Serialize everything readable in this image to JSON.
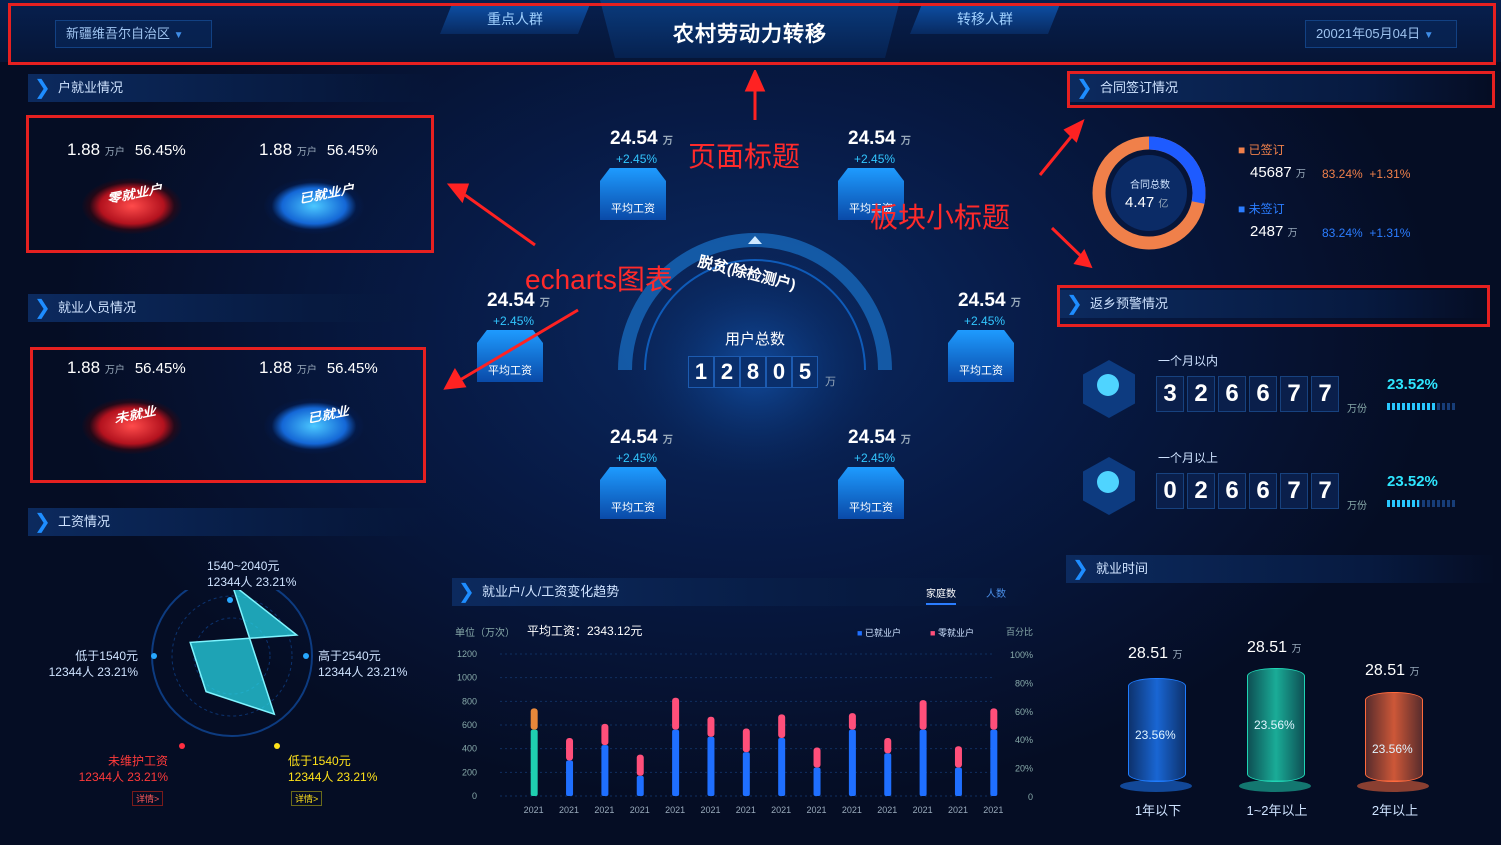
{
  "header": {
    "title": "农村劳动力转移",
    "region": "新疆维吾尔自治区",
    "tab_left": "重点人群",
    "tab_right": "转移人群",
    "date": "20021年05月04日"
  },
  "left": {
    "household": {
      "title": "户就业情况",
      "stats": [
        {
          "value": "1.88",
          "unit": "万户",
          "pct": "56.45%",
          "label": "零就业户"
        },
        {
          "value": "1.88",
          "unit": "万户",
          "pct": "56.45%",
          "label": "已就业户"
        }
      ]
    },
    "personnel": {
      "title": "就业人员情况",
      "stats": [
        {
          "value": "1.88",
          "unit": "万户",
          "pct": "56.45%",
          "label": "未就业"
        },
        {
          "value": "1.88",
          "unit": "万户",
          "pct": "56.45%",
          "label": "已就业"
        }
      ]
    },
    "wage": {
      "title": "工资情况",
      "points": [
        {
          "label": "1540~2040元",
          "sub": "12344人  23.21%"
        },
        {
          "label": "高于2540元",
          "sub": "12344人  23.21%"
        },
        {
          "label": "低于1540元",
          "sub": "12344人  23.21%"
        },
        {
          "label": "未维护工资",
          "sub": "12344人  23.21%"
        },
        {
          "label": "低于1540元",
          "sub": "12344人  23.21%"
        }
      ],
      "radar_values": [
        0.9,
        0.85,
        0.55,
        0.55,
        0.9
      ],
      "detail_left": "详情>",
      "detail_right": "详情>"
    }
  },
  "center": {
    "cubes": [
      {
        "value": "24.54",
        "unit": "万",
        "pct": "+2.45%",
        "label": "平均工资"
      },
      {
        "value": "24.54",
        "unit": "万",
        "pct": "+2.45%",
        "label": "平均工资"
      },
      {
        "value": "24.54",
        "unit": "万",
        "pct": "+2.45%",
        "label": "平均工资"
      },
      {
        "value": "24.54",
        "unit": "万",
        "pct": "+2.45%",
        "label": "平均工资"
      },
      {
        "value": "24.54",
        "unit": "万",
        "pct": "+2.45%",
        "label": "平均工资"
      },
      {
        "value": "24.54",
        "unit": "万",
        "pct": "+2.45%",
        "label": "平均工资"
      }
    ],
    "arc_label": "脱贫(除检测户)",
    "total_label": "用户总数",
    "total_digits": [
      "1",
      "2",
      "8",
      "0",
      "5"
    ],
    "total_unit": "万"
  },
  "trend": {
    "title": "就业户/人/工资变化趋势",
    "tab_active": "家庭数",
    "tab_other": "人数",
    "unit_label": "单位（万次）",
    "avg_wage": "平均工资：2343.12元",
    "legend": [
      {
        "name": "已就业户",
        "color": "#1f6fff"
      },
      {
        "name": "零就业户",
        "color": "#ff4f7a"
      }
    ],
    "right_axis_label": "百分比"
  },
  "chart_data": {
    "type": "bar",
    "categories": [
      "2021",
      "2021",
      "2021",
      "2021",
      "2021",
      "2021",
      "2021",
      "2021",
      "2021",
      "2021",
      "2021",
      "2021",
      "2021",
      "2021"
    ],
    "series": [
      {
        "name": "已就业户",
        "values": [
          560,
          300,
          430,
          170,
          560,
          500,
          370,
          490,
          240,
          560,
          360,
          560,
          240,
          560
        ]
      },
      {
        "name": "零就业户",
        "values": [
          180,
          190,
          180,
          180,
          270,
          170,
          200,
          200,
          170,
          140,
          130,
          250,
          180,
          180
        ]
      }
    ],
    "ylim": [
      0,
      1200
    ],
    "yticks": [
      "1200",
      "1000",
      "800",
      "600",
      "400",
      "200",
      "0"
    ],
    "y2ticks": [
      "100%",
      "80%",
      "60%",
      "40%",
      "20%",
      "0"
    ]
  },
  "right": {
    "contract": {
      "title": "合同签订情况",
      "center_label": "合同总数",
      "center_value": "4.47",
      "center_unit": "亿",
      "signed_label": "已签订",
      "signed_value": "45687",
      "signed_unit": "万",
      "signed_pct": "83.24%",
      "signed_delta": "+1.31%",
      "unsigned_label": "未签订",
      "unsigned_value": "2487",
      "unsigned_unit": "万",
      "unsigned_pct": "83.24%",
      "unsigned_delta": "+1.31%",
      "signed_share": 0.72
    },
    "warning": {
      "title": "返乡预警情况",
      "rows": [
        {
          "label": "一个月以内",
          "digits": [
            "3",
            "2",
            "6",
            "6",
            "7",
            "7"
          ],
          "unit": "万份",
          "pct": "23.52%",
          "level": 0.7
        },
        {
          "label": "一个月以上",
          "digits": [
            "0",
            "2",
            "6",
            "6",
            "7",
            "7"
          ],
          "unit": "万份",
          "pct": "23.52%",
          "level": 0.45
        }
      ]
    },
    "employ_time": {
      "title": "就业时间",
      "items": [
        {
          "value": "28.51",
          "unit": "万",
          "pct": "23.56%",
          "label": "1年以下",
          "color": "#1e7cff"
        },
        {
          "value": "28.51",
          "unit": "万",
          "pct": "23.56%",
          "label": "1~2年以上",
          "color": "#1fd4b4"
        },
        {
          "value": "28.51",
          "unit": "万",
          "pct": "23.56%",
          "label": "2年以上",
          "color": "#ff6a3d"
        }
      ]
    }
  },
  "annotations": {
    "page_title": "页面标题",
    "section_title": "板块小标题",
    "echarts": "echarts图表"
  }
}
